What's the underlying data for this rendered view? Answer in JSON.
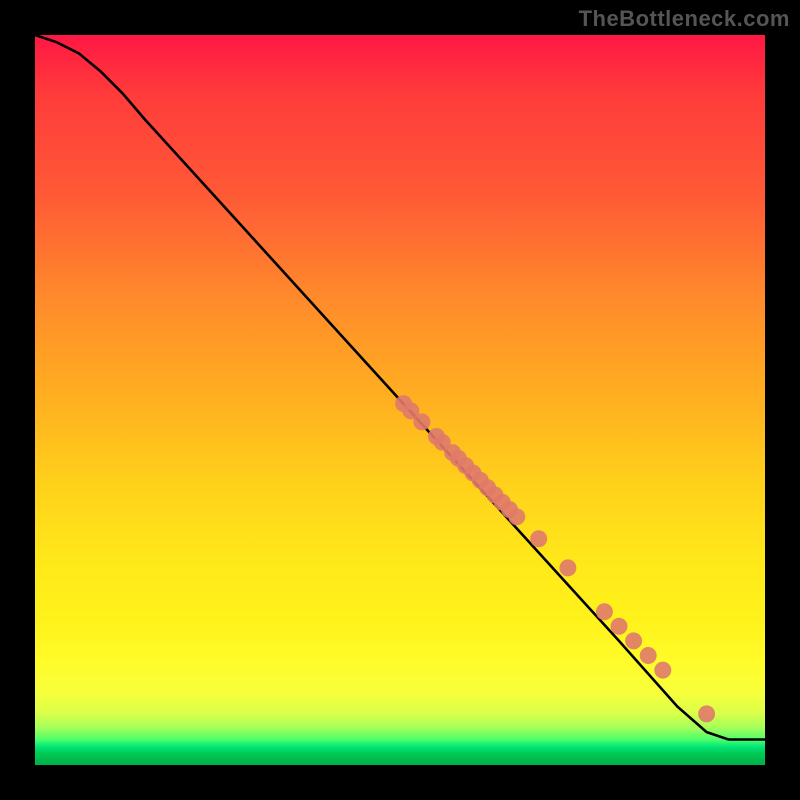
{
  "watermark": "TheBottleneck.com",
  "colors": {
    "curve": "#000000",
    "dot_fill": "#e07a6a",
    "dot_stroke": "#c96a5a",
    "plot_bg_top": "#ff1744",
    "plot_bg_bottom": "#00b04a",
    "page_bg": "#000000"
  },
  "chart_data": {
    "type": "line",
    "title": "",
    "xlabel": "",
    "ylabel": "",
    "xlim": [
      0,
      100
    ],
    "ylim": [
      0,
      100
    ],
    "curve": [
      {
        "x": 0,
        "y": 100
      },
      {
        "x": 3,
        "y": 99
      },
      {
        "x": 6,
        "y": 97.5
      },
      {
        "x": 9,
        "y": 95
      },
      {
        "x": 12,
        "y": 92
      },
      {
        "x": 15,
        "y": 88.5
      },
      {
        "x": 20,
        "y": 83
      },
      {
        "x": 30,
        "y": 72
      },
      {
        "x": 40,
        "y": 61
      },
      {
        "x": 50,
        "y": 50
      },
      {
        "x": 60,
        "y": 39
      },
      {
        "x": 70,
        "y": 28
      },
      {
        "x": 80,
        "y": 17
      },
      {
        "x": 88,
        "y": 8
      },
      {
        "x": 92,
        "y": 4.5
      },
      {
        "x": 95,
        "y": 3.5
      },
      {
        "x": 100,
        "y": 3.5
      }
    ],
    "series": [
      {
        "name": "points",
        "points": [
          {
            "x": 50.5,
            "y": 49.5
          },
          {
            "x": 51.5,
            "y": 48.5
          },
          {
            "x": 53.0,
            "y": 47.0
          },
          {
            "x": 55.0,
            "y": 45.0
          },
          {
            "x": 55.8,
            "y": 44.2
          },
          {
            "x": 57.2,
            "y": 42.8
          },
          {
            "x": 58.0,
            "y": 42.0
          },
          {
            "x": 59.0,
            "y": 41.0
          },
          {
            "x": 60.0,
            "y": 40.0
          },
          {
            "x": 61.0,
            "y": 39.0
          },
          {
            "x": 62.0,
            "y": 38.0
          },
          {
            "x": 63.0,
            "y": 37.0
          },
          {
            "x": 64.0,
            "y": 36.0
          },
          {
            "x": 65.0,
            "y": 35.0
          },
          {
            "x": 66.0,
            "y": 34.0
          },
          {
            "x": 69.0,
            "y": 31.0
          },
          {
            "x": 73.0,
            "y": 27.0
          },
          {
            "x": 78.0,
            "y": 21.0
          },
          {
            "x": 80.0,
            "y": 19.0
          },
          {
            "x": 82.0,
            "y": 17.0
          },
          {
            "x": 84.0,
            "y": 15.0
          },
          {
            "x": 86.0,
            "y": 13.0
          },
          {
            "x": 92.0,
            "y": 7.0
          }
        ]
      }
    ]
  }
}
